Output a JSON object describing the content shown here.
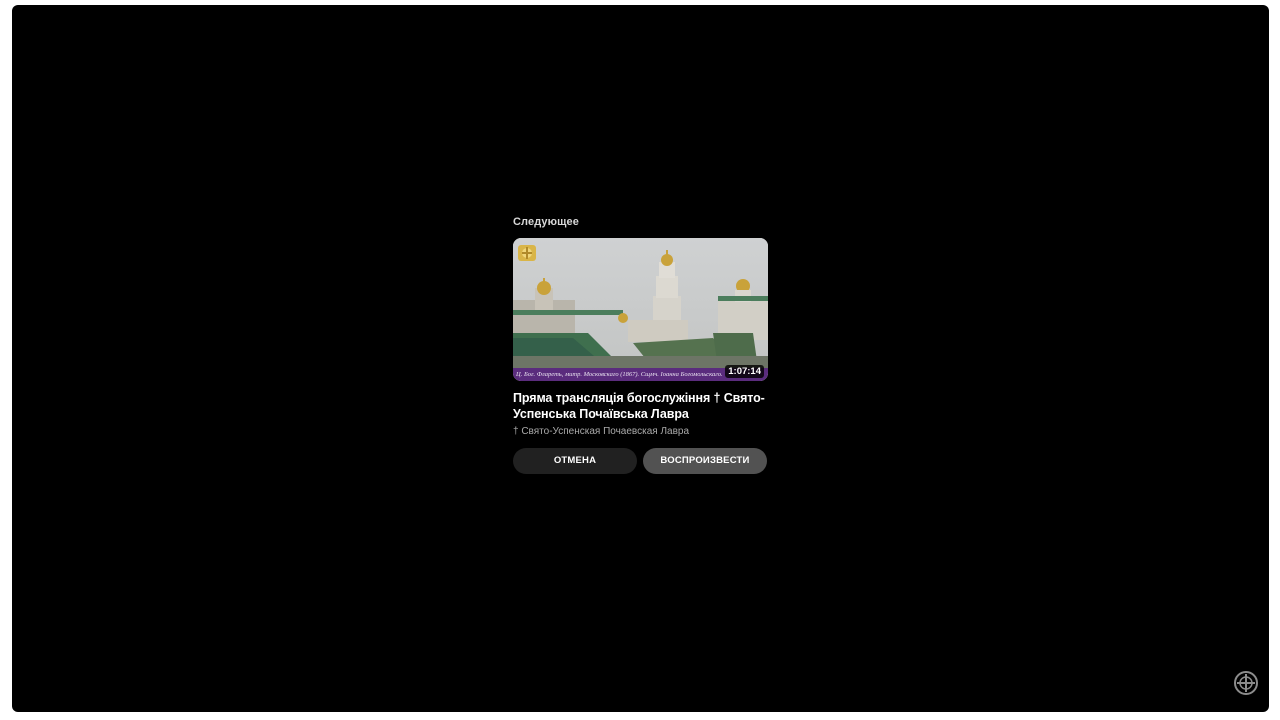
{
  "endscreen": {
    "up_next_label": "Следующее",
    "video": {
      "title": "Пряма трансляція богослужіння † Свято-Успенська Почаївська Лавра",
      "channel": "† Свято-Успенская Почаевская Лавра",
      "duration": "1:07:14",
      "thumbnail_caption": "Ц. Бог. Флареть, митр. Московскаго (1867). Сщмч. Іоанна Богомольскаго."
    },
    "cancel_label": "ОТМЕНА",
    "play_label": "ВОСПРОИЗВЕСТИ"
  },
  "icons": {
    "thumbnail_logo": "monastery-logo-icon",
    "watermark": "channel-watermark-icon"
  },
  "colors": {
    "player_background": "#000000",
    "cancel_button": "#212121",
    "play_button": "#525252",
    "caption_strip": "#5a2c7d"
  }
}
